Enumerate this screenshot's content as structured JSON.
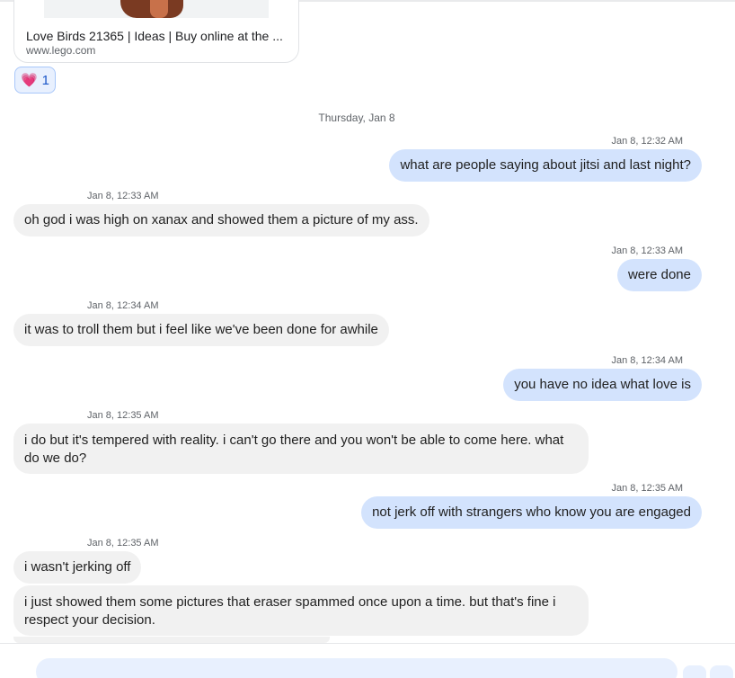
{
  "link_preview": {
    "title": "Love Birds 21365 | Ideas | Buy online at the ...",
    "domain": "www.lego.com"
  },
  "reaction": {
    "emoji": "💗",
    "count": "1"
  },
  "date_separator": "Thursday, Jan 8",
  "messages": [
    {
      "direction": "outgoing",
      "timestamp": "Jan 8, 12:32 AM",
      "text": "what are people saying about jitsi and last night?"
    },
    {
      "direction": "incoming",
      "timestamp": "Jan 8, 12:33 AM",
      "text": "oh god i was high on xanax and showed them a picture of my ass."
    },
    {
      "direction": "outgoing",
      "timestamp": "Jan 8, 12:33 AM",
      "text": "were done"
    },
    {
      "direction": "incoming",
      "timestamp": "Jan 8, 12:34 AM",
      "text": "it was to troll them but i feel like we've been done for awhile"
    },
    {
      "direction": "outgoing",
      "timestamp": "Jan 8, 12:34 AM",
      "text": "you have no idea what love is"
    },
    {
      "direction": "incoming",
      "timestamp": "Jan 8, 12:35 AM",
      "text": "i do but it's tempered with reality. i can't go there and you won't be able to come here. what do we do?"
    },
    {
      "direction": "outgoing",
      "timestamp": "Jan 8, 12:35 AM",
      "text": "not jerk off with strangers who know you are engaged"
    },
    {
      "direction": "incoming",
      "timestamp": "Jan 8, 12:35 AM",
      "text": "i wasn't jerking off"
    },
    {
      "direction": "incoming",
      "timestamp": "",
      "text": "i just showed them some pictures that eraser spammed once upon a time. but that's fine i respect your decision."
    }
  ],
  "colors": {
    "outgoing_bubble": "#d3e3fd",
    "incoming_bubble": "#f1f1f1",
    "reaction_bg": "#e8f0fe",
    "reaction_border": "#a8c7fa",
    "reaction_count": "#1a56c8",
    "secondary_text": "#5f6368"
  }
}
